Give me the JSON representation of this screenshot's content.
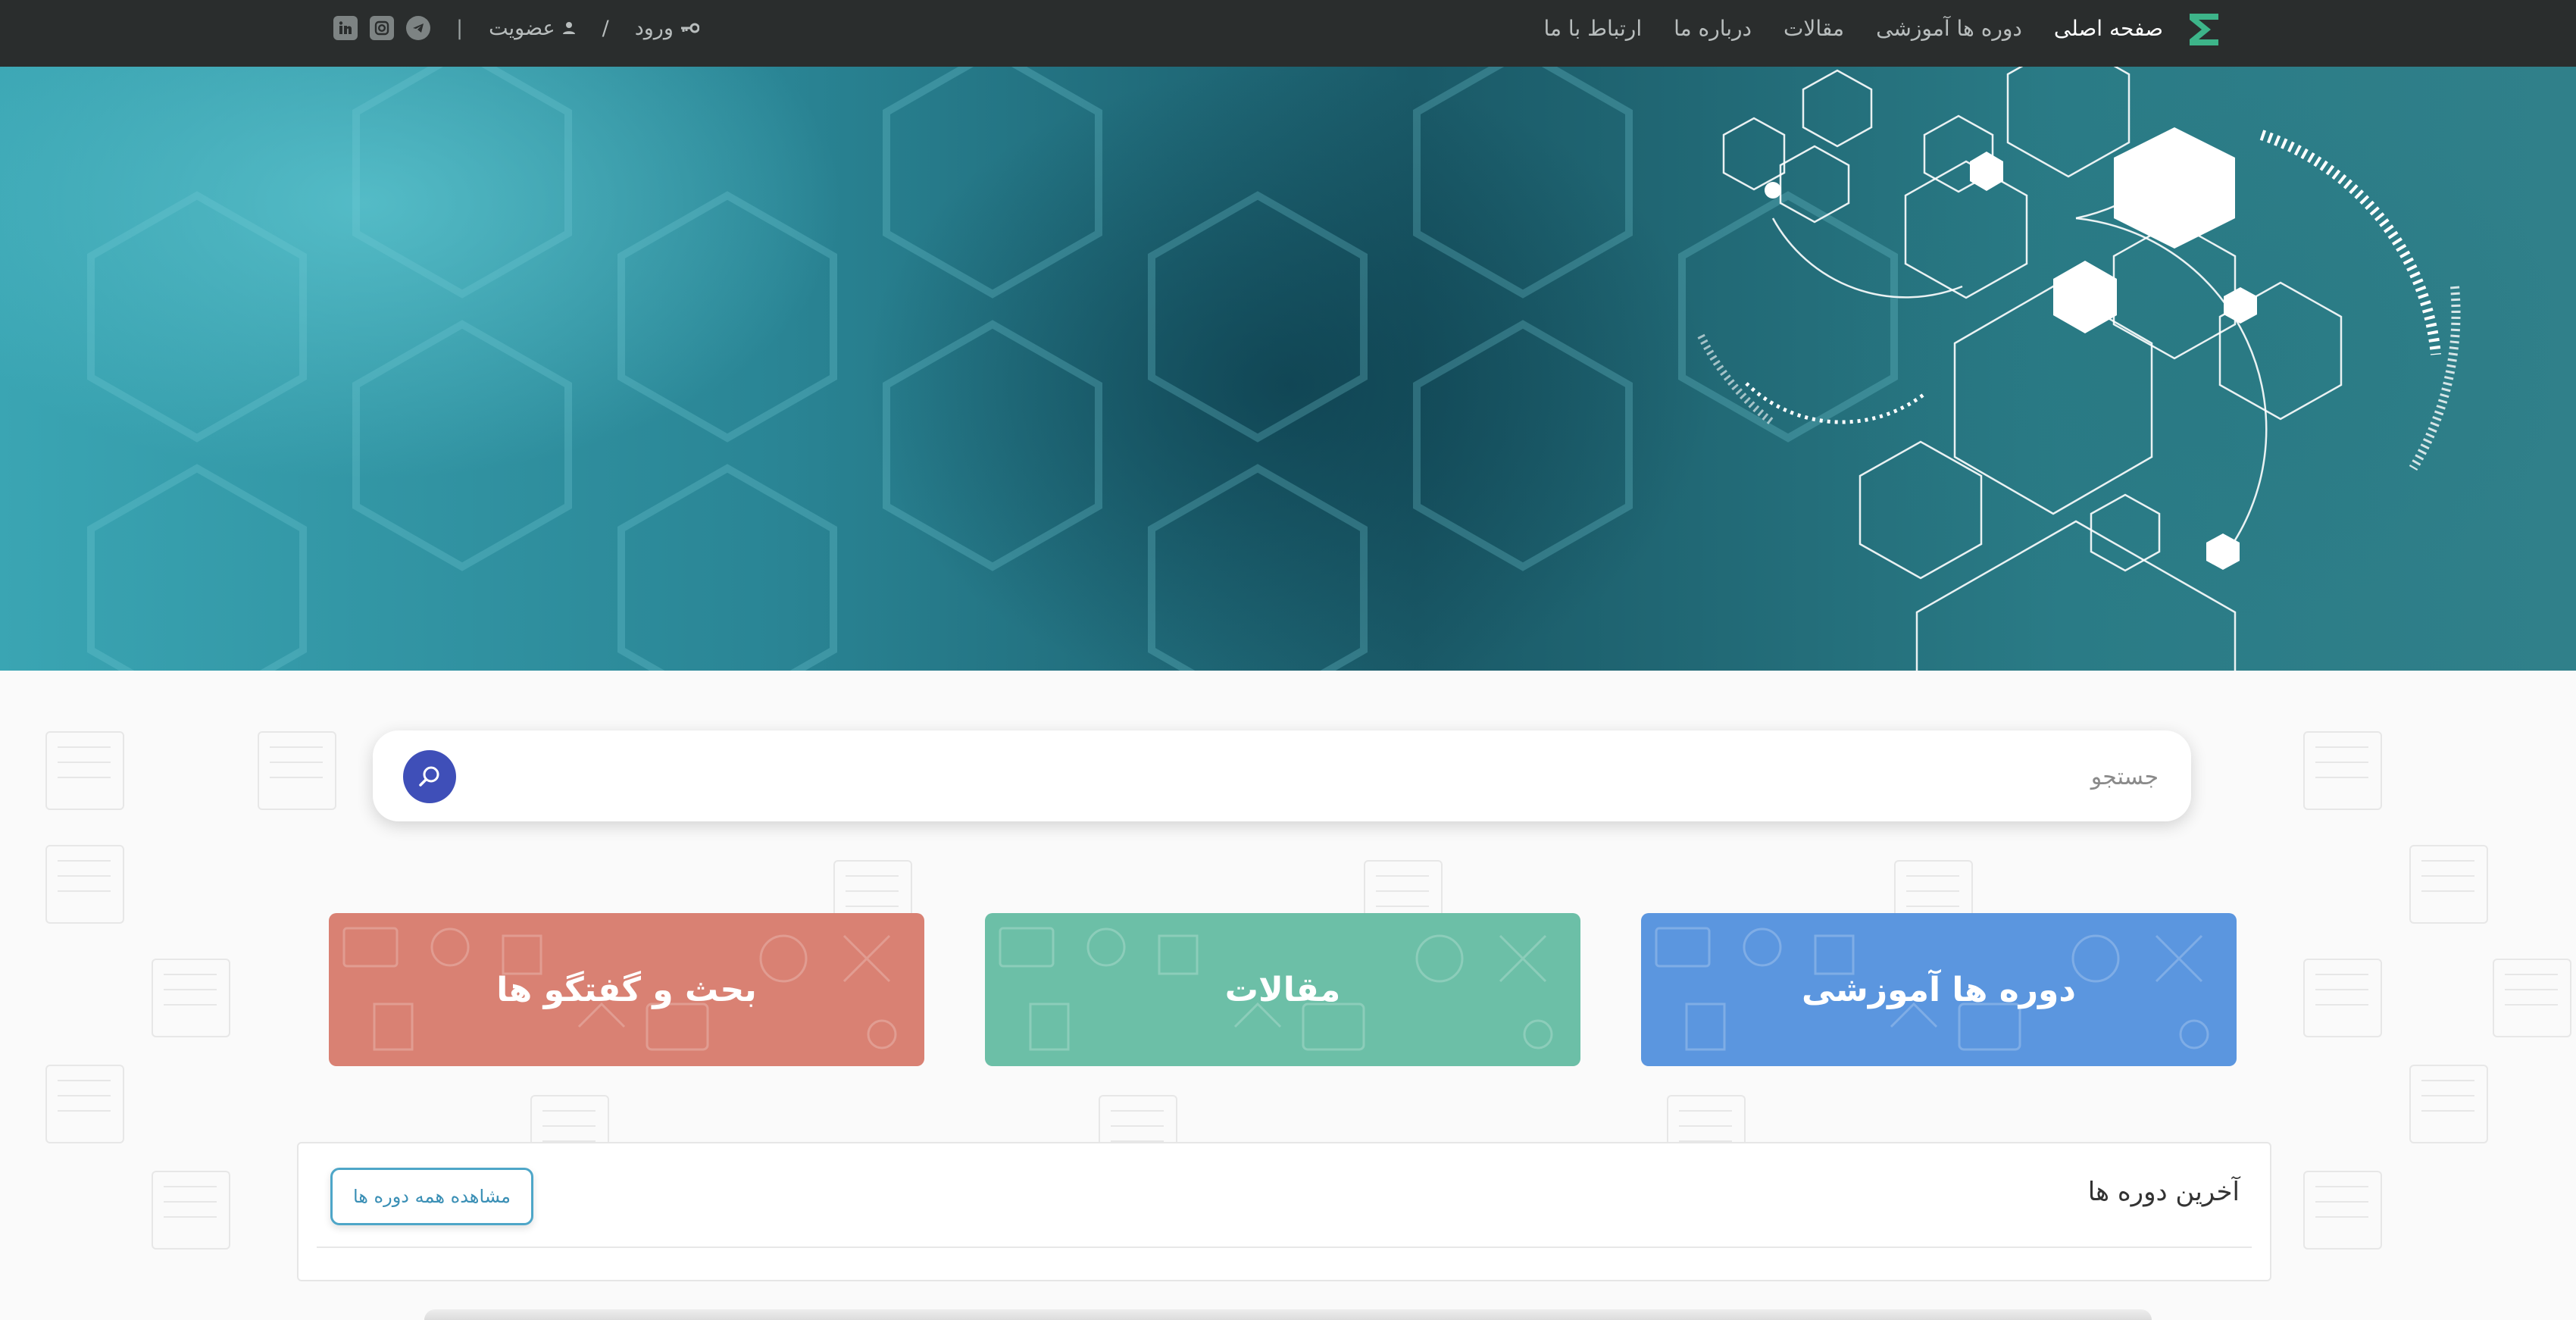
{
  "navbar": {
    "logo_icon": "brand-logo-icon",
    "menu": [
      {
        "label": "صفحه اصلی",
        "active": true
      },
      {
        "label": "دوره ها آموزشی",
        "active": false
      },
      {
        "label": "مقالات",
        "active": false
      },
      {
        "label": "درباره ما",
        "active": false
      },
      {
        "label": "ارتباط با ما",
        "active": false
      }
    ],
    "login_label": "ورود",
    "register_label": "عضویت",
    "separator": "|",
    "slash": "/",
    "social_icons": [
      "linkedin-icon",
      "instagram-icon",
      "telegram-icon"
    ],
    "bar_color": "#2a2d2d"
  },
  "search": {
    "placeholder": "جستجو",
    "value": "",
    "button_color": "#3f4fb8"
  },
  "cards": [
    {
      "label": "دوره ها آموزشی",
      "color": "#5b96df"
    },
    {
      "label": "مقالات",
      "color": "#6cbfa7"
    },
    {
      "label": "بحث و گفتگو ها",
      "color": "#d98173"
    }
  ],
  "latest_courses": {
    "title": "آخرین دوره ها",
    "view_all_label": "مشاهده همه دوره ها"
  }
}
